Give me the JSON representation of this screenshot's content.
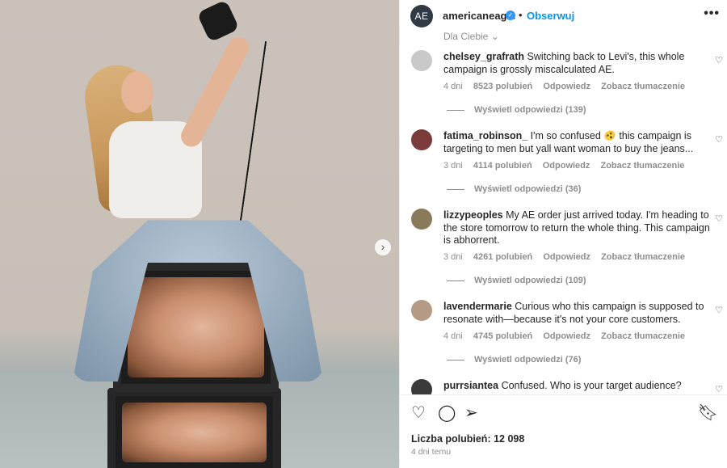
{
  "post": {
    "avatar_text": "AE",
    "username": "americaneagle",
    "verified_glyph": "✓",
    "dot": "•",
    "follow_label": "Obserwuj",
    "more_label": "•••",
    "next_glyph": "›"
  },
  "sort_label": "Dla Ciebie ⌄",
  "reply_label": "Odpowiedz",
  "translate_label": "Zobacz tłumaczenie",
  "comments": [
    {
      "username": "chelsey_grafrath",
      "text": "Switching back to Levi's, this whole campaign is grossly miscalculated AE.",
      "age": "4 dni",
      "likes": "8523 polubień",
      "replies": "Wyświetl odpowiedzi (139)",
      "avatar_color": "#c9c9c9"
    },
    {
      "username": "fatima_robinson_",
      "text": "I'm so confused 🫨 this campaign is targeting to men but yall want woman to buy the jeans...",
      "age": "3 dni",
      "likes": "4114 polubień",
      "replies": "Wyświetl odpowiedzi (36)",
      "avatar_color": "#7a3b3b"
    },
    {
      "username": "lizzypeoples",
      "text": "My AE order just arrived today. I'm heading to the store tomorrow to return the whole thing. This campaign is abhorrent.",
      "age": "3 dni",
      "likes": "4261 polubień",
      "replies": "Wyświetl odpowiedzi (109)",
      "avatar_color": "#8a7a5c"
    },
    {
      "username": "lavendermarie",
      "text": "Curious who this campaign is supposed to resonate with—because it's not your core customers.",
      "age": "4 dni",
      "likes": "4745 polubień",
      "replies": "Wyświetl odpowiedzi (76)",
      "avatar_color": "#b59a86"
    },
    {
      "username": "purrsiantea",
      "text": "Confused. Who is your target audience?",
      "avatar_color": "#3a3a3a"
    }
  ],
  "actions": {
    "like_glyph": "♡",
    "comment_glyph": "◯",
    "share_glyph": "➢",
    "save_glyph": "🔖︎",
    "likes_text": "Liczba polubień: 12 098",
    "date_text": "4 dni temu"
  },
  "heart_glyph": "♡"
}
